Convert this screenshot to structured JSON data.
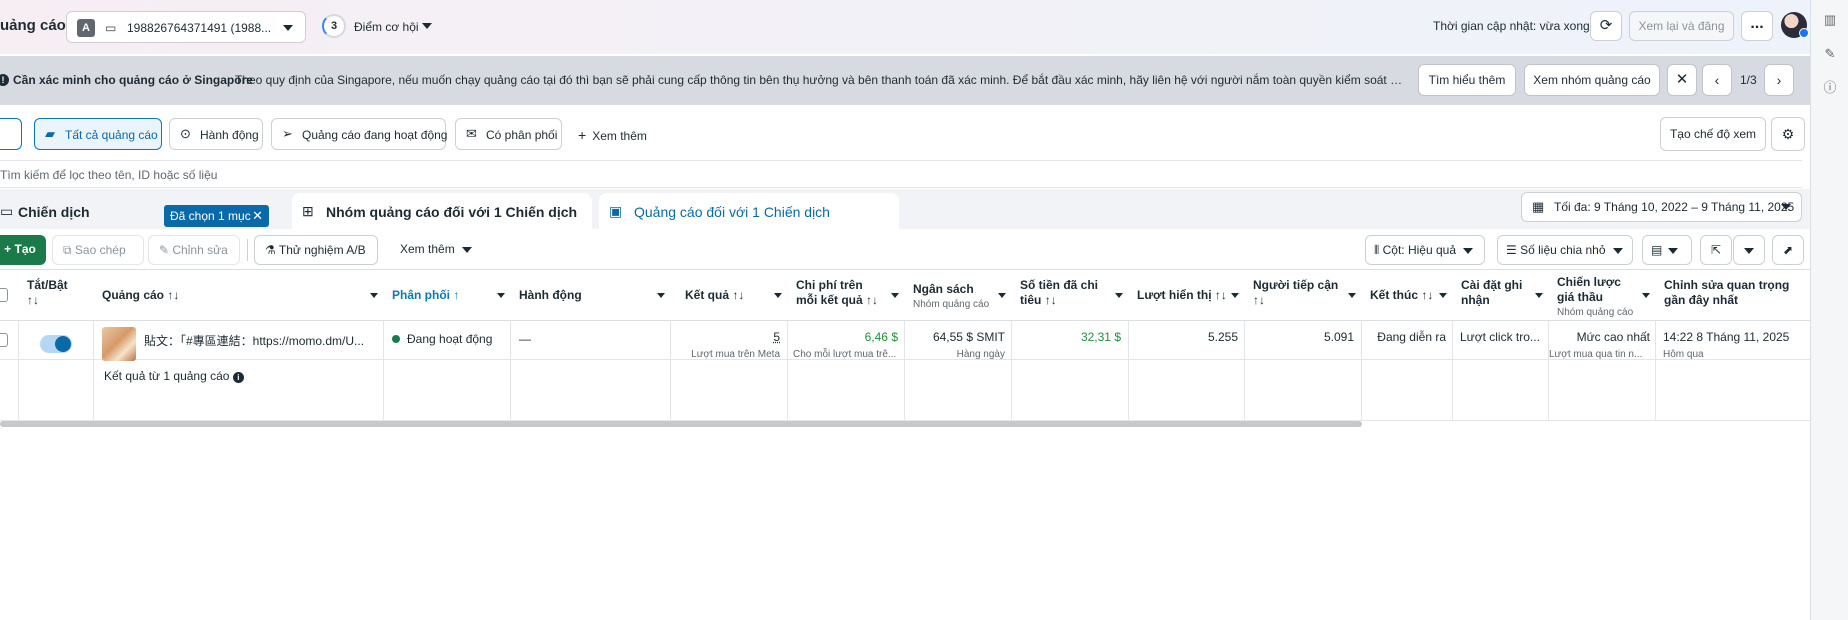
{
  "header": {
    "title": "uảng cáo",
    "account_letter": "A",
    "account": "198826764371491 (1988...",
    "score_value": "3",
    "score_label": "Điểm cơ hội",
    "updated": "Thời gian cập nhật: vừa xong",
    "review_button": "Xem lại và đăng",
    "more_label": "..."
  },
  "banner": {
    "title": "Cần xác minh cho quảng cáo ở Singapore",
    "text": "Theo quy định của Singapore, nếu muốn chạy quảng cáo tại đó thì bạn sẽ phải cung cấp thông tin bên thụ hưởng và bên thanh toán đã xác minh. Để bắt đầu xác minh, hãy liên hệ với người nắm toàn quyền kiểm soát tài khoản quản...",
    "learn_more": "Tìm hiểu thêm",
    "view_adsets": "Xem nhóm quảng cáo",
    "pager": "1/3"
  },
  "filters": {
    "all_ads": "Tất cả quảng cáo",
    "actions": "Hành động",
    "active_ads": "Quảng cáo đang hoạt động",
    "delivered": "Có phân phối",
    "see_more": "Xem thêm",
    "create_view": "Tạo chế độ xem",
    "search_placeholder": "Tìm kiếm để lọc theo tên, ID hoặc số liệu"
  },
  "tabs": {
    "campaign": "Chiến dịch",
    "selected_pill": "Đã chọn 1 mục",
    "adsets": "Nhóm quảng cáo đối với 1 Chiến dịch",
    "ads": "Quảng cáo đối với 1 Chiến dịch",
    "date_range": "Tối đa: 9 Tháng 10, 2022 – 9 Tháng 11, 2025"
  },
  "toolbar": {
    "create": "Tạo",
    "copy": "Sao chép",
    "edit": "Chỉnh sửa",
    "ab_test": "Thử nghiệm A/B",
    "more": "Xem thêm",
    "columns": "Cột: Hiệu quả",
    "breakdown": "Số liệu chia nhỏ"
  },
  "table": {
    "headers": {
      "toggle": "Tắt/Bật",
      "ad": "Quảng cáo",
      "delivery": "Phân phối",
      "actions": "Hành động",
      "results": "Kết quả",
      "cost_per_result": "Chi phí trên mỗi kết quả",
      "budget": "Ngân sách",
      "budget_sub": "Nhóm quảng cáo",
      "amount_spent": "Số tiền đã chi tiêu",
      "impressions": "Lượt hiển thị",
      "reach": "Người tiếp cận",
      "ends": "Kết thúc",
      "attribution": "Cài đặt ghi nhận",
      "bid_strategy": "Chiến lược giá thầu",
      "bid_strategy_sub": "Nhóm quảng cáo",
      "last_edit": "Chỉnh sửa quan trọng gần đây nhất"
    },
    "sort_glyph": "↑↓",
    "sort_up": "↑",
    "row": {
      "ad_name": "貼文：「#專區連結：https://momo.dm/U...",
      "delivery": "Đang hoạt động",
      "actions": "—",
      "results": "5",
      "results_sub": "Lượt mua trên Meta",
      "cost": "6,46 $",
      "cost_sub": "Cho mỗi lượt mua trê...",
      "budget": "64,55 $ SMIT",
      "budget_sub": "Hàng ngày",
      "spent": "32,31 $",
      "impressions": "5.255",
      "reach": "5.091",
      "ends": "Đang diễn ra",
      "attribution": "Lượt click tro...",
      "bid": "Mức cao nhất",
      "bid_sub": "Lượt mua qua tin n...",
      "last_edit": "14:22 8 Tháng 11, 2025",
      "last_edit_sub": "Hôm qua"
    },
    "summary": "Kết quả từ 1 quảng cáo"
  }
}
